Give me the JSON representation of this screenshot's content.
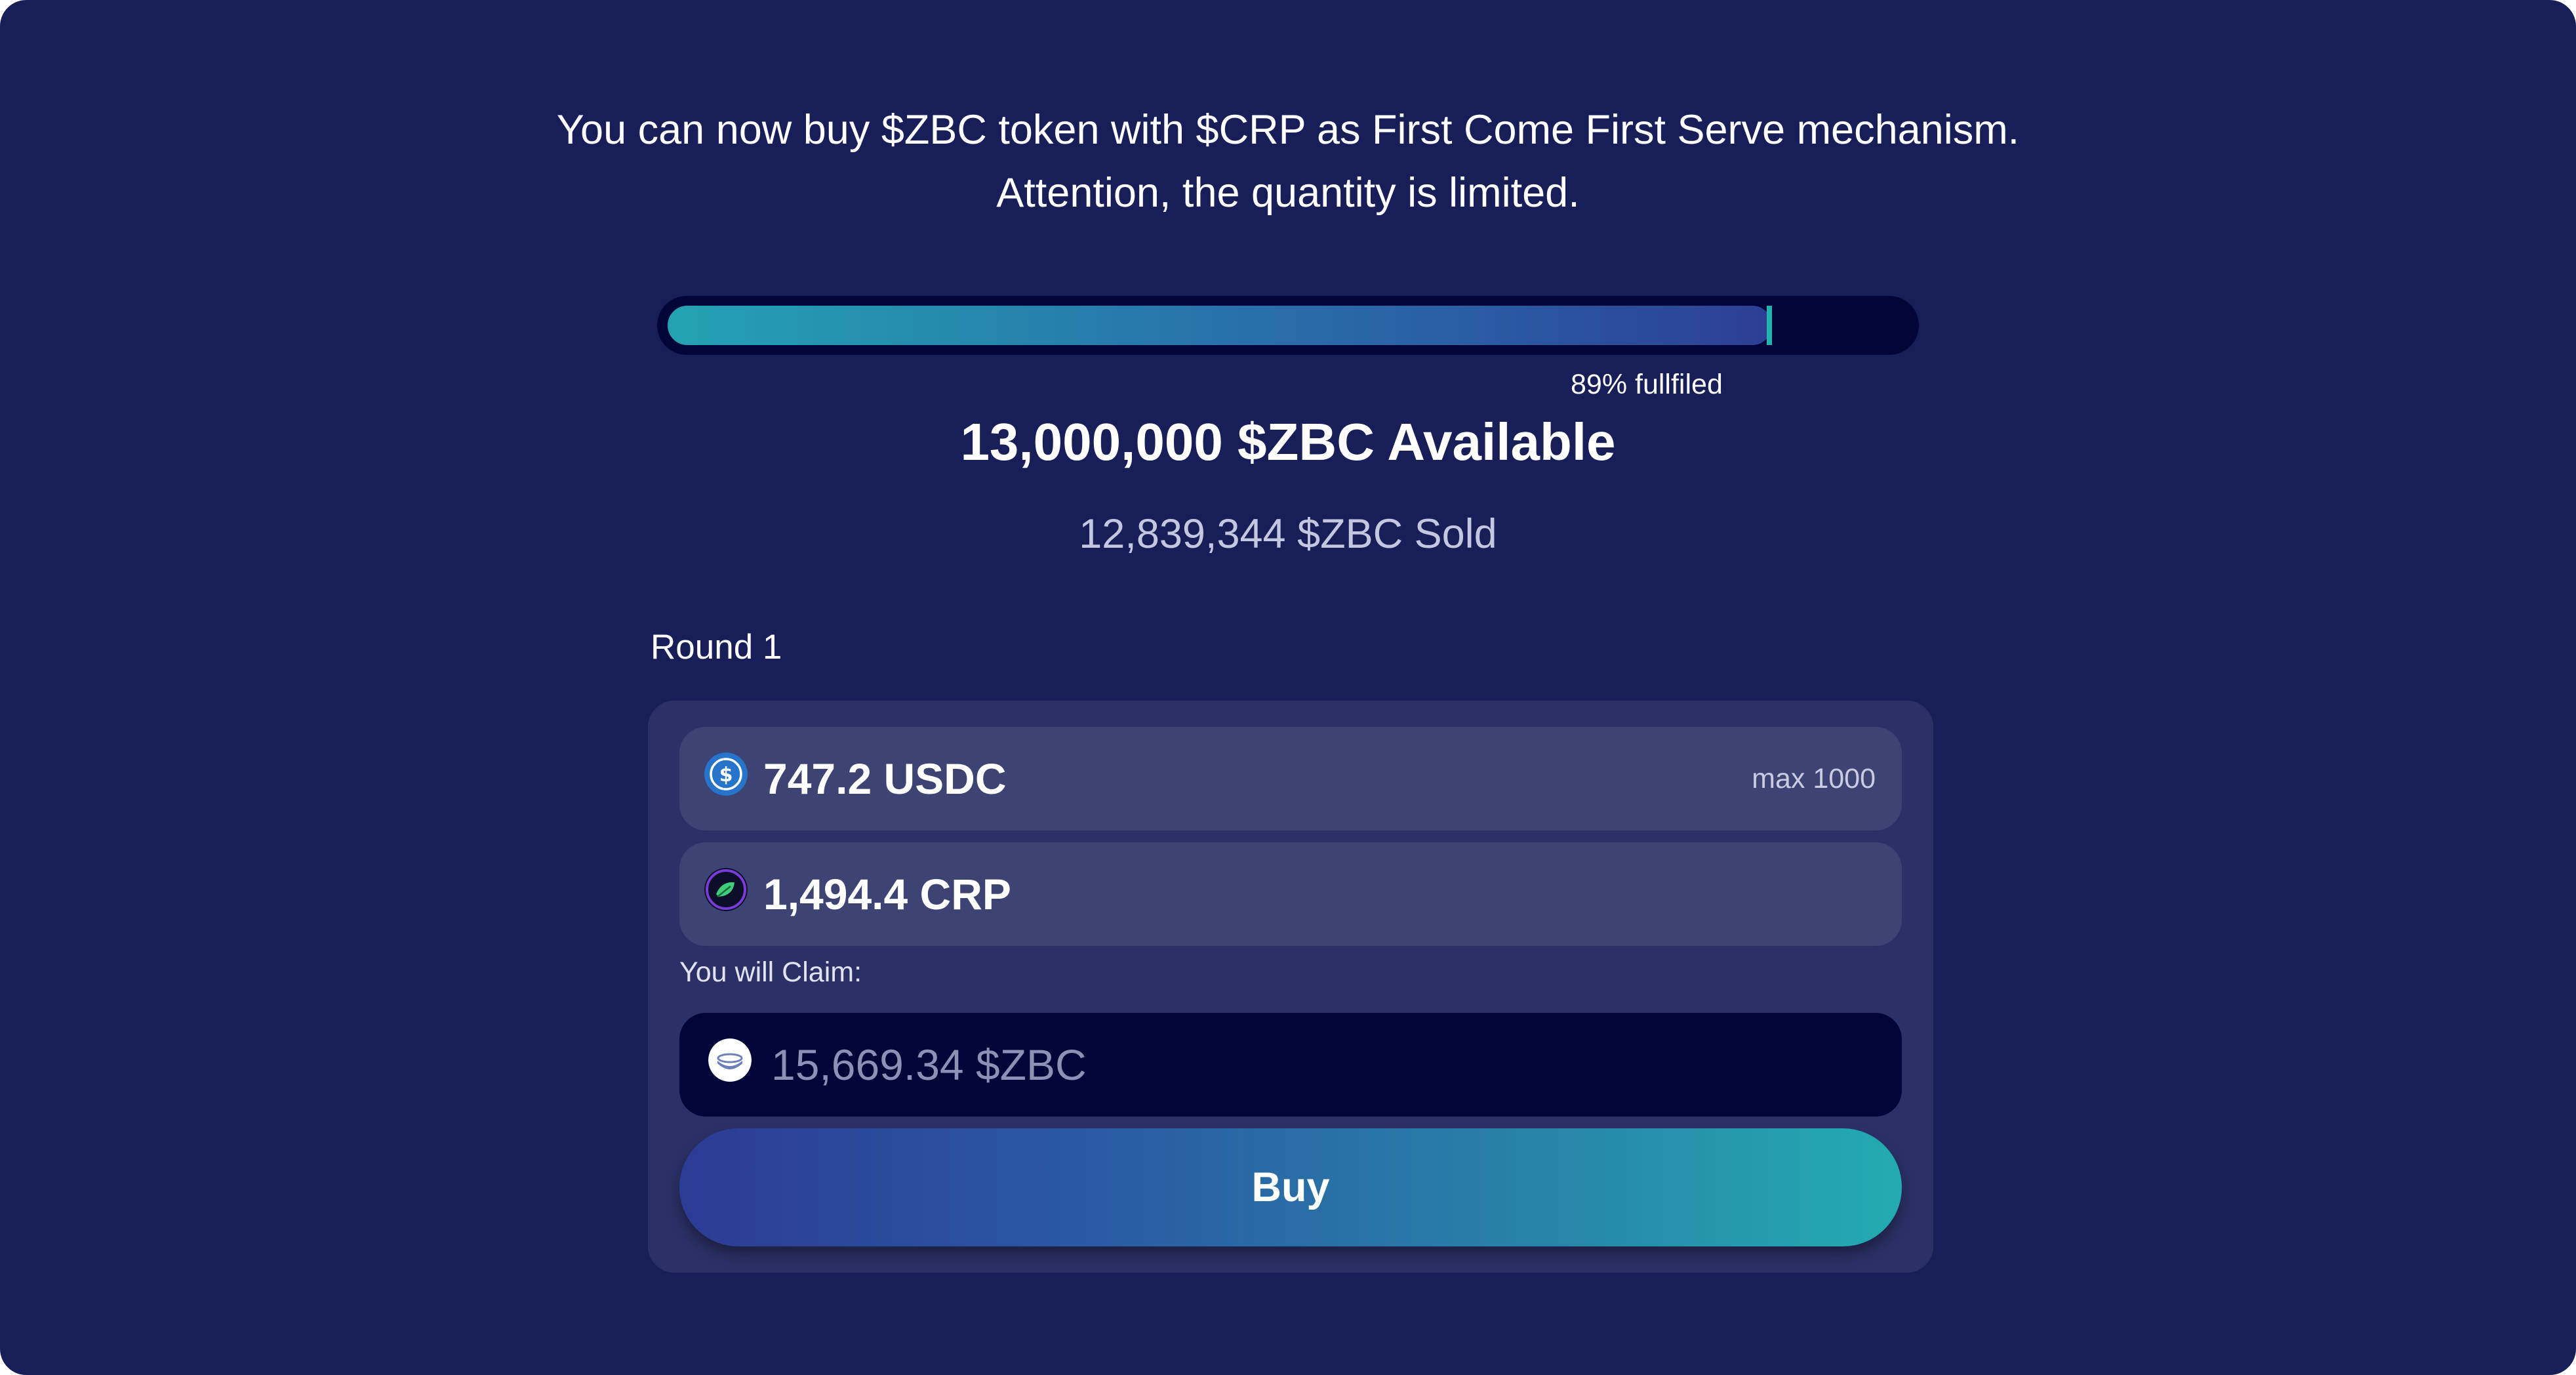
{
  "intro": {
    "line1": "You can now buy $ZBC token with $CRP as First Come First Serve mechanism.",
    "line2": "Attention, the quantity is limited."
  },
  "progress": {
    "fraction": 0.89,
    "label": "89% fullfiled"
  },
  "available_text": "13,000,000 $ZBC Available",
  "sold_text": "12,839,344 $ZBC Sold",
  "round_label": "Round 1",
  "usdc_field": {
    "icon": "usdc-icon",
    "value": "747.2 USDC",
    "max_label": "max 1000"
  },
  "crp_field": {
    "icon": "crp-icon",
    "value": "1,494.4 CRP"
  },
  "claim": {
    "label": "You will Claim:",
    "icon": "zbc-icon",
    "value": "15,669.34 $ZBC"
  },
  "buy_button": {
    "label": "Buy"
  },
  "colors": {
    "background": "#181f58",
    "card": "#2b3166",
    "field": "#3d4473",
    "claim_field": "#010538",
    "accent_teal": "#23abb1",
    "accent_blue": "#2c3b95"
  }
}
